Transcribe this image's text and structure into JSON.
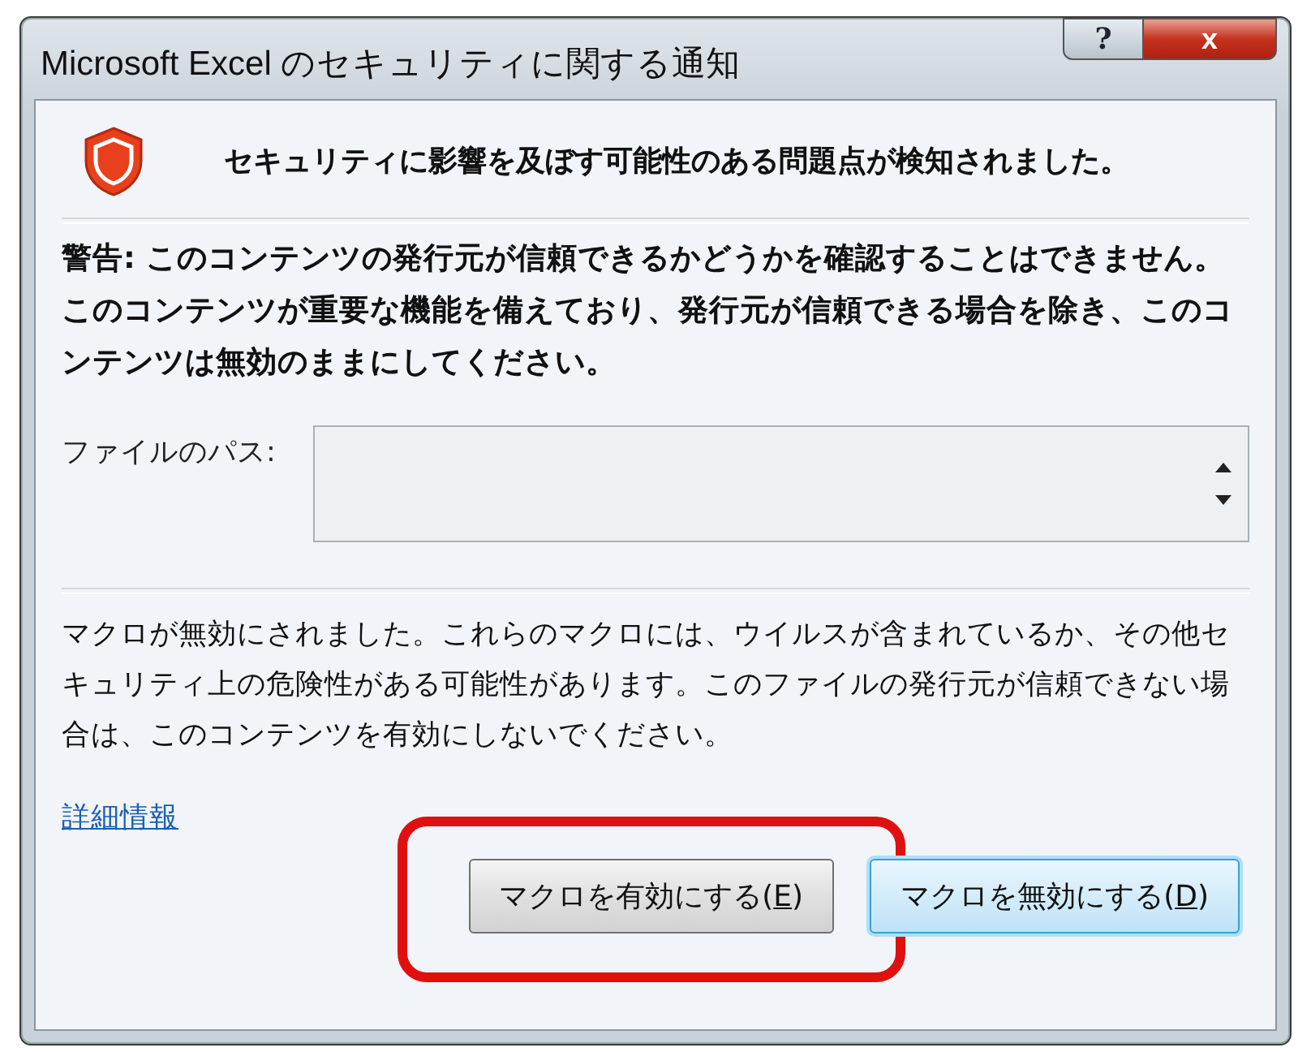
{
  "window": {
    "title": "Microsoft Excel のセキュリティに関する通知",
    "help_button": "?",
    "close_button": "x"
  },
  "headline": "セキュリティに影響を及ぼす可能性のある問題点が検知されました。",
  "warning": "警告: このコンテンツの発行元が信頼できるかどうかを確認することはできません。このコンテンツが重要な機能を備えており、発行元が信頼できる場合を除き、このコンテンツは無効のままにしてください。",
  "file_path": {
    "label": "ファイルのパス:"
  },
  "message": "マクロが無効にされました。これらのマクロには、ウイルスが含まれているか、その他セキュリティ上の危険性がある可能性があります。このファイルの発行元が信頼できない場合は、このコンテンツを有効にしないでください。",
  "link": "詳細情報",
  "buttons": [
    {
      "text_before": "マクロを有効にする(",
      "access_key": "E",
      "text_after": ")",
      "focused": false,
      "highlighted": true
    },
    {
      "text_before": "マクロを無効にする(",
      "access_key": "D",
      "text_after": ")",
      "focused": true,
      "highlighted": false
    }
  ]
}
